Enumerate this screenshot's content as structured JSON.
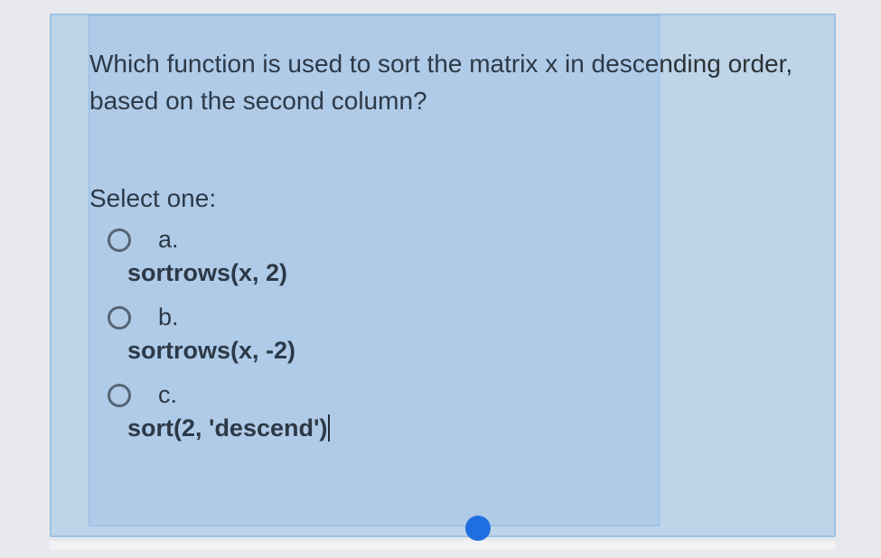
{
  "question": "Which function is used to sort the matrix x in descending order, based on the second column?",
  "select_label": "Select one:",
  "options": [
    {
      "letter": "a.",
      "code": "sortrows(x, 2)"
    },
    {
      "letter": "b.",
      "code": "sortrows(x, -2)"
    },
    {
      "letter": "c.",
      "code": "sort(2, 'descend')"
    }
  ]
}
